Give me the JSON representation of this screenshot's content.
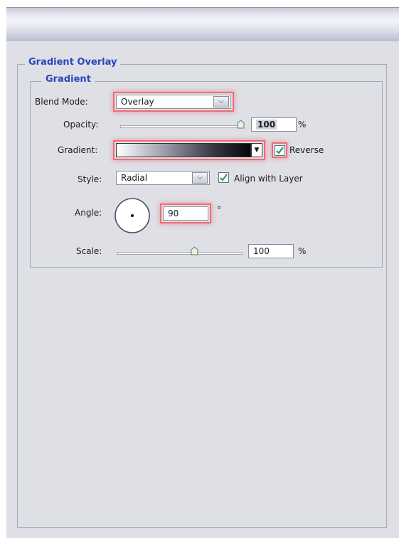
{
  "section": {
    "title": "Gradient Overlay",
    "subsection": "Gradient"
  },
  "blend_mode": {
    "label": "Blend Mode:",
    "value": "Overlay"
  },
  "opacity": {
    "label": "Opacity:",
    "value": "100",
    "unit": "%",
    "level": 1.0
  },
  "gradient": {
    "label": "Gradient:",
    "reverse_label": "Reverse",
    "reverse_checked": true
  },
  "style": {
    "label": "Style:",
    "value": "Radial",
    "align_label": "Align with Layer",
    "align_checked": true
  },
  "angle": {
    "label": "Angle:",
    "value": "90",
    "unit": "°"
  },
  "scale": {
    "label": "Scale:",
    "value": "100",
    "unit": "%"
  },
  "colors": {
    "highlight": "#f06a74",
    "legend_blue": "#2a47b8",
    "check_green": "#2e9a3a"
  }
}
